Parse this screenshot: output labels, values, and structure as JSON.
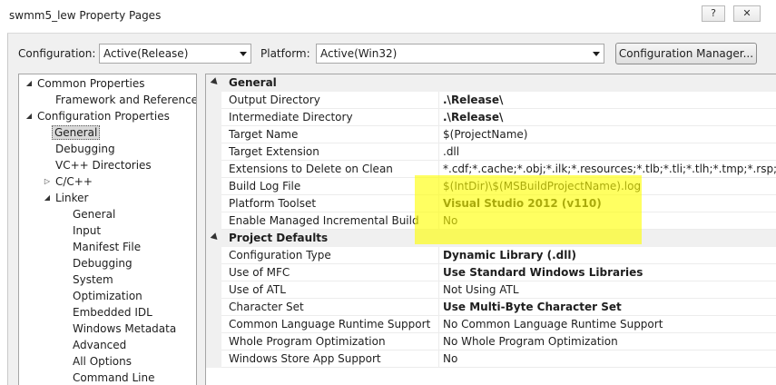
{
  "window": {
    "title": "swmm5_lew Property Pages",
    "help_glyph": "?",
    "close_glyph": "✕"
  },
  "toolbar": {
    "configuration_label": "Configuration:",
    "configuration_value": "Active(Release)",
    "platform_label": "Platform:",
    "platform_value": "Active(Win32)",
    "config_manager_label": "Configuration Manager..."
  },
  "tree": {
    "items": [
      {
        "label": "Common Properties",
        "expander": "◢"
      },
      {
        "label": "Framework and References"
      },
      {
        "label": "Configuration Properties",
        "expander": "◢"
      },
      {
        "label": "General",
        "selected": true
      },
      {
        "label": "Debugging"
      },
      {
        "label": "VC++ Directories"
      },
      {
        "label": "C/C++",
        "expander": "▷"
      },
      {
        "label": "Linker",
        "expander": "◢"
      },
      {
        "label": "General"
      },
      {
        "label": "Input"
      },
      {
        "label": "Manifest File"
      },
      {
        "label": "Debugging"
      },
      {
        "label": "System"
      },
      {
        "label": "Optimization"
      },
      {
        "label": "Embedded IDL"
      },
      {
        "label": "Windows Metadata"
      },
      {
        "label": "Advanced"
      },
      {
        "label": "All Options"
      },
      {
        "label": "Command Line"
      }
    ]
  },
  "grid": {
    "general_header": "General",
    "general_rows": [
      {
        "name": "Output Directory",
        "value": ".\\Release\\",
        "bold": true
      },
      {
        "name": "Intermediate Directory",
        "value": ".\\Release\\",
        "bold": true
      },
      {
        "name": "Target Name",
        "value": "$(ProjectName)",
        "bold": false
      },
      {
        "name": "Target Extension",
        "value": ".dll",
        "bold": false
      },
      {
        "name": "Extensions to Delete on Clean",
        "value": "*.cdf;*.cache;*.obj;*.ilk;*.resources;*.tlb;*.tli;*.tlh;*.tmp;*.rsp;*.pgc;*.p",
        "bold": false
      },
      {
        "name": "Build Log File",
        "value": "$(IntDir)\\$(MSBuildProjectName).log",
        "bold": false
      },
      {
        "name": "Platform Toolset",
        "value": "Visual Studio 2012 (v110)",
        "bold": true
      },
      {
        "name": "Enable Managed Incremental Build",
        "value": "No",
        "bold": false
      }
    ],
    "defaults_header": "Project Defaults",
    "defaults_rows": [
      {
        "name": "Configuration Type",
        "value": "Dynamic Library (.dll)",
        "bold": true
      },
      {
        "name": "Use of MFC",
        "value": "Use Standard Windows Libraries",
        "bold": true
      },
      {
        "name": "Use of ATL",
        "value": "Not Using ATL",
        "bold": false
      },
      {
        "name": "Character Set",
        "value": "Use Multi-Byte Character Set",
        "bold": true
      },
      {
        "name": "Common Language Runtime Support",
        "value": "No Common Language Runtime Support",
        "bold": false
      },
      {
        "name": "Whole Program Optimization",
        "value": "No Whole Program Optimization",
        "bold": false
      },
      {
        "name": "Windows Store App Support",
        "value": "No",
        "bold": false
      }
    ]
  },
  "colors": {
    "highlight": "#ffff00",
    "dialog_bg": "#f0f0f0",
    "selection": "#d9d9d9"
  }
}
